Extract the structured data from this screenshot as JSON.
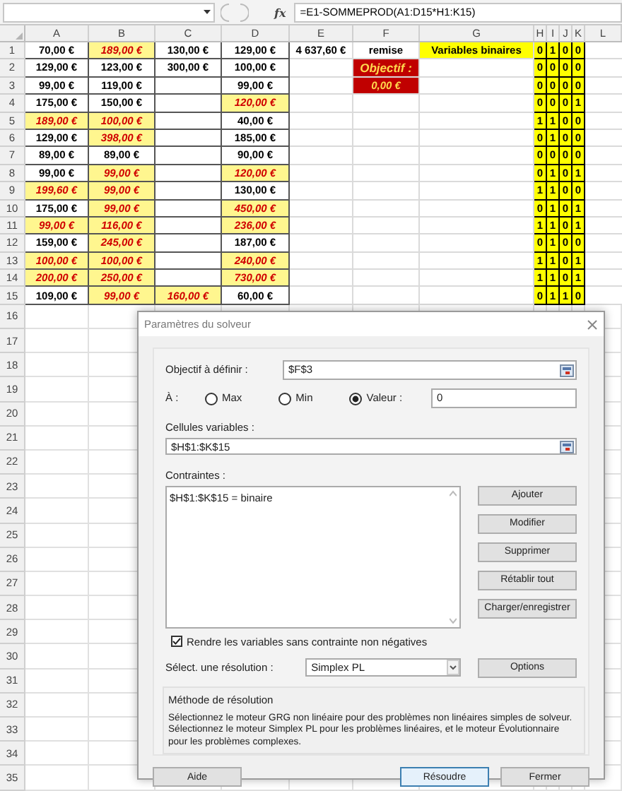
{
  "formula_bar": {
    "fx_label": "fx",
    "formula": "=E1-SOMMEPROD(A1:D15*H1:K15)"
  },
  "columns": [
    "A",
    "B",
    "C",
    "D",
    "E",
    "F",
    "G",
    "H",
    "I",
    "J",
    "K",
    "L"
  ],
  "summary": {
    "total": "4 637,60 €",
    "remise_label": "remise",
    "binary_label": "Variables binaires",
    "objective_label": "Objectif :",
    "objective_value": "0,00 €"
  },
  "rows": [
    {
      "number": "1",
      "A": {
        "value": "70,00 €",
        "selected": false
      },
      "B": {
        "value": "189,00 €",
        "selected": true
      },
      "C": {
        "value": "130,00 €",
        "selected": false
      },
      "D": {
        "value": "129,00 €",
        "selected": false
      },
      "bits": [
        "0",
        "1",
        "0",
        "0"
      ]
    },
    {
      "number": "2",
      "A": {
        "value": "129,00 €",
        "selected": false
      },
      "B": {
        "value": "123,00 €",
        "selected": false
      },
      "C": {
        "value": "300,00 €",
        "selected": false
      },
      "D": {
        "value": "100,00 €",
        "selected": false
      },
      "bits": [
        "0",
        "0",
        "0",
        "0"
      ]
    },
    {
      "number": "3",
      "A": {
        "value": "99,00 €",
        "selected": false
      },
      "B": {
        "value": "119,00 €",
        "selected": false
      },
      "D": {
        "value": "99,00 €",
        "selected": false
      },
      "bits": [
        "0",
        "0",
        "0",
        "0"
      ]
    },
    {
      "number": "4",
      "A": {
        "value": "175,00 €",
        "selected": false
      },
      "B": {
        "value": "150,00 €",
        "selected": false
      },
      "D": {
        "value": "120,00 €",
        "selected": true
      },
      "bits": [
        "0",
        "0",
        "0",
        "1"
      ]
    },
    {
      "number": "5",
      "A": {
        "value": "189,00 €",
        "selected": true
      },
      "B": {
        "value": "100,00 €",
        "selected": true
      },
      "D": {
        "value": "40,00 €",
        "selected": false
      },
      "bits": [
        "1",
        "1",
        "0",
        "0"
      ]
    },
    {
      "number": "6",
      "A": {
        "value": "129,00 €",
        "selected": false
      },
      "B": {
        "value": "398,00 €",
        "selected": true
      },
      "D": {
        "value": "185,00 €",
        "selected": false
      },
      "bits": [
        "0",
        "1",
        "0",
        "0"
      ]
    },
    {
      "number": "7",
      "A": {
        "value": "89,00 €",
        "selected": false
      },
      "B": {
        "value": "89,00 €",
        "selected": false
      },
      "D": {
        "value": "90,00 €",
        "selected": false
      },
      "bits": [
        "0",
        "0",
        "0",
        "0"
      ]
    },
    {
      "number": "8",
      "A": {
        "value": "99,00 €",
        "selected": false
      },
      "B": {
        "value": "99,00 €",
        "selected": true
      },
      "D": {
        "value": "120,00 €",
        "selected": true
      },
      "bits": [
        "0",
        "1",
        "0",
        "1"
      ]
    },
    {
      "number": "9",
      "A": {
        "value": "199,60 €",
        "selected": true
      },
      "B": {
        "value": "99,00 €",
        "selected": true
      },
      "D": {
        "value": "130,00 €",
        "selected": false
      },
      "bits": [
        "1",
        "1",
        "0",
        "0"
      ]
    },
    {
      "number": "10",
      "A": {
        "value": "175,00 €",
        "selected": false
      },
      "B": {
        "value": "99,00 €",
        "selected": true
      },
      "D": {
        "value": "450,00 €",
        "selected": true
      },
      "bits": [
        "0",
        "1",
        "0",
        "1"
      ]
    },
    {
      "number": "11",
      "A": {
        "value": "99,00 €",
        "selected": true
      },
      "B": {
        "value": "116,00 €",
        "selected": true
      },
      "D": {
        "value": "236,00 €",
        "selected": true
      },
      "bits": [
        "1",
        "1",
        "0",
        "1"
      ]
    },
    {
      "number": "12",
      "A": {
        "value": "159,00 €",
        "selected": false
      },
      "B": {
        "value": "245,00 €",
        "selected": true
      },
      "D": {
        "value": "187,00 €",
        "selected": false
      },
      "bits": [
        "0",
        "1",
        "0",
        "0"
      ]
    },
    {
      "number": "13",
      "A": {
        "value": "100,00 €",
        "selected": true
      },
      "B": {
        "value": "100,00 €",
        "selected": true
      },
      "D": {
        "value": "240,00 €",
        "selected": true
      },
      "bits": [
        "1",
        "1",
        "0",
        "1"
      ]
    },
    {
      "number": "14",
      "A": {
        "value": "200,00 €",
        "selected": true
      },
      "B": {
        "value": "250,00 €",
        "selected": true
      },
      "D": {
        "value": "730,00 €",
        "selected": true
      },
      "bits": [
        "1",
        "1",
        "0",
        "1"
      ]
    },
    {
      "number": "15",
      "A": {
        "value": "109,00 €",
        "selected": false
      },
      "B": {
        "value": "99,00 €",
        "selected": true
      },
      "C": {
        "value": "160,00 €",
        "selected": true
      },
      "D": {
        "value": "60,00 €",
        "selected": false
      },
      "bits": [
        "0",
        "1",
        "1",
        "0"
      ]
    }
  ],
  "empty_rows": [
    "16",
    "17",
    "18",
    "19",
    "20",
    "21",
    "22",
    "23",
    "24",
    "25",
    "26",
    "27",
    "28",
    "29",
    "30",
    "31",
    "32",
    "33",
    "34",
    "35"
  ],
  "dialog": {
    "title": "Paramètres du solveur",
    "objective": {
      "label": "Objectif à définir :",
      "value": "$F$3"
    },
    "to": {
      "label": "À :",
      "options": [
        {
          "label": "Max",
          "selected": false
        },
        {
          "label": "Min",
          "selected": false
        },
        {
          "label": "Valeur :",
          "selected": true
        }
      ],
      "value": "0"
    },
    "variables": {
      "label": "Cellules variables :",
      "value": "$H$1:$K$15"
    },
    "constraints": {
      "label": "Contraintes :",
      "items": [
        "$H$1:$K$15 = binaire"
      ]
    },
    "side_buttons": [
      "Ajouter",
      "Modifier",
      "Supprimer",
      "Rétablir tout",
      "Charger/enregistrer"
    ],
    "nonneg": {
      "label": "Rendre les variables sans contrainte non négatives",
      "checked": true
    },
    "method": {
      "label": "Sélect. une résolution :",
      "value": "Simplex PL"
    },
    "options_button": "Options",
    "method_box": {
      "title": "Méthode de résolution",
      "text": "Sélectionnez le moteur GRG non linéaire pour des problèmes non linéaires simples de solveur. Sélectionnez le moteur Simplex PL pour les problèmes linéaires, et le moteur Évolutionnaire pour les problèmes complexes."
    },
    "buttons": [
      {
        "label": "Aide",
        "default": false
      },
      {
        "label": "Résoudre",
        "default": true
      },
      {
        "label": "Fermer",
        "default": false
      }
    ]
  }
}
